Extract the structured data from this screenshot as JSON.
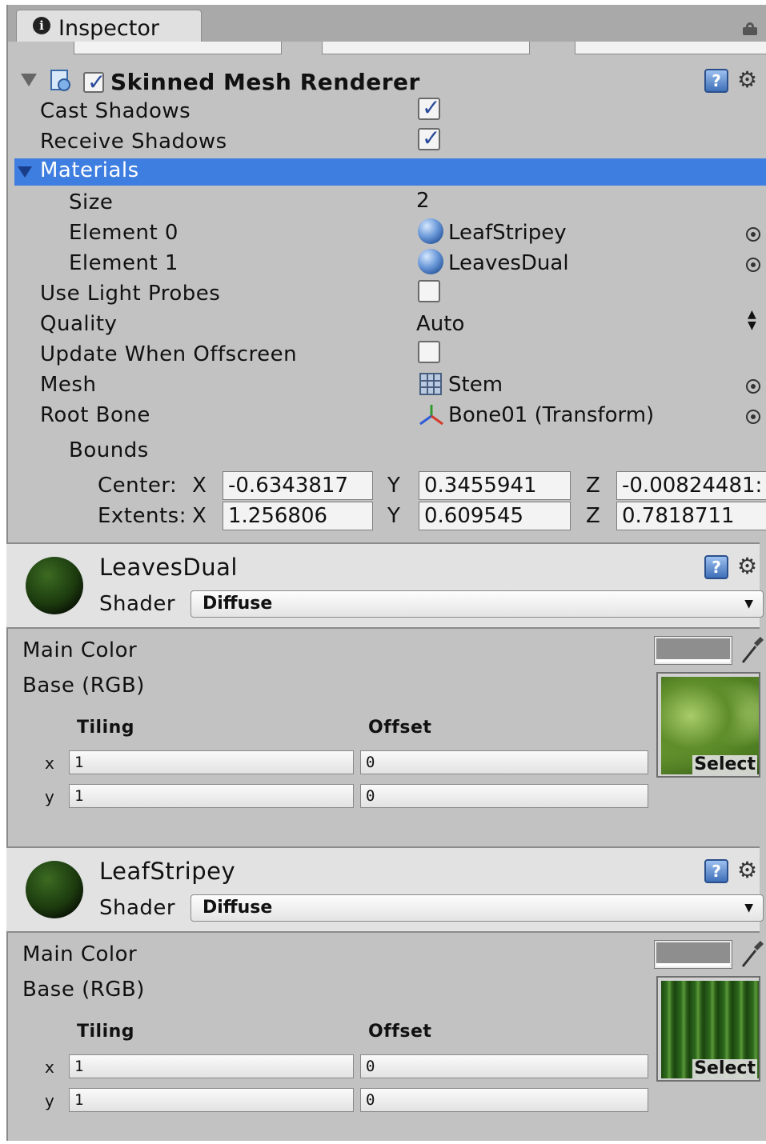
{
  "tab": {
    "title": "Inspector"
  },
  "component": {
    "title": "Skinned Mesh Renderer",
    "enabled": true,
    "props": {
      "cast_shadows": {
        "label": "Cast Shadows",
        "checked": true
      },
      "receive_shadows": {
        "label": "Receive Shadows",
        "checked": true
      },
      "materials": {
        "label": "Materials"
      },
      "size": {
        "label": "Size",
        "value": "2"
      },
      "element0": {
        "label": "Element 0",
        "value": "LeafStripey"
      },
      "element1": {
        "label": "Element 1",
        "value": "LeavesDual"
      },
      "use_light_probes": {
        "label": "Use Light Probes",
        "checked": false
      },
      "quality": {
        "label": "Quality",
        "value": "Auto"
      },
      "update_offscreen": {
        "label": "Update When Offscreen",
        "checked": false
      },
      "mesh": {
        "label": "Mesh",
        "value": "Stem"
      },
      "root_bone": {
        "label": "Root Bone",
        "value": "Bone01 (Transform)"
      },
      "bounds": {
        "label": "Bounds"
      }
    },
    "center": {
      "label": "Center:",
      "x_label": "X",
      "y_label": "Y",
      "z_label": "Z",
      "x": "-0.6343817",
      "y": "0.3455941",
      "z": "-0.00824481:"
    },
    "extents": {
      "label": "Extents:",
      "x_label": "X",
      "y_label": "Y",
      "z_label": "Z",
      "x": "1.256806",
      "y": "0.609545",
      "z": "0.7818711"
    }
  },
  "materials": [
    {
      "name": "LeavesDual",
      "shader_label": "Shader",
      "shader": "Diffuse",
      "main_color_label": "Main Color",
      "base_label": "Base (RGB)",
      "tiling_label": "Tiling",
      "offset_label": "Offset",
      "x_label": "x",
      "y_label": "y",
      "tiling_x": "1",
      "tiling_y": "1",
      "offset_x": "0",
      "offset_y": "0",
      "select_label": "Select",
      "main_color": "#8e8e8e"
    },
    {
      "name": "LeafStripey",
      "shader_label": "Shader",
      "shader": "Diffuse",
      "main_color_label": "Main Color",
      "base_label": "Base (RGB)",
      "tiling_label": "Tiling",
      "offset_label": "Offset",
      "x_label": "x",
      "y_label": "y",
      "tiling_x": "1",
      "tiling_y": "1",
      "offset_x": "0",
      "offset_y": "0",
      "select_label": "Select",
      "main_color": "#8e8e8e"
    }
  ],
  "colors": {
    "selection_blue": "#3d7ee0",
    "panel_gray": "#c2c2c2",
    "header_gray": "#e2e2e2"
  },
  "icons": [
    "info-icon",
    "lock-icon",
    "foldout-arrow-icon",
    "skinned-mesh-icon",
    "help-icon",
    "gear-icon",
    "material-sphere-icon",
    "object-picker-icon",
    "mesh-grid-icon",
    "transform-axes-icon",
    "eyedropper-icon"
  ]
}
